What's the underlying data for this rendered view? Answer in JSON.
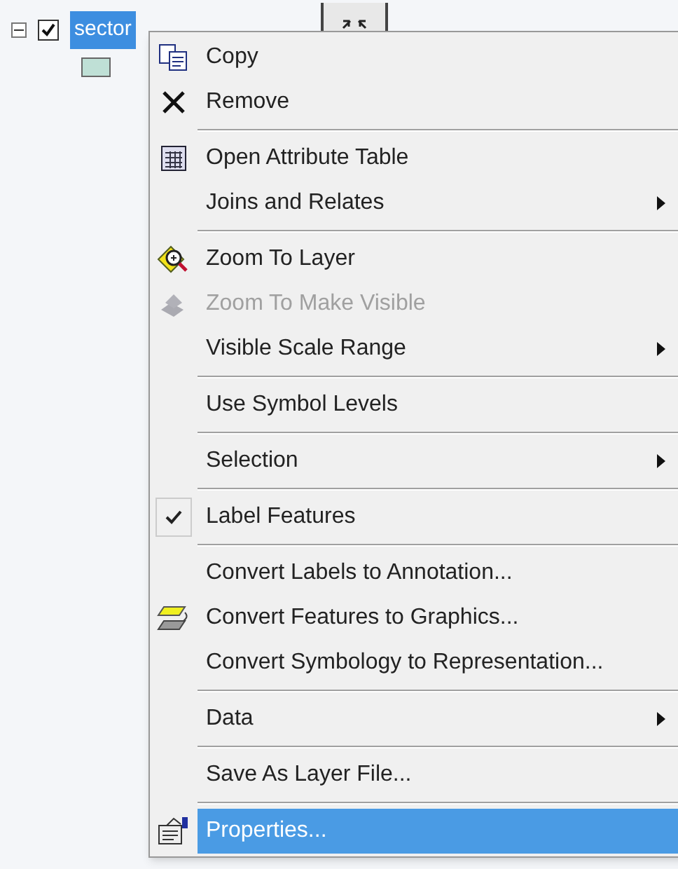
{
  "layer": {
    "expanded": true,
    "checked": true,
    "name": "sector",
    "selected": true
  },
  "menu": {
    "items": [
      {
        "kind": "item",
        "label": "Copy",
        "disabled": false,
        "checked": false,
        "submenu": false,
        "selected": false
      },
      {
        "kind": "item",
        "label": "Remove",
        "disabled": false,
        "checked": false,
        "submenu": false,
        "selected": false
      },
      {
        "kind": "separator"
      },
      {
        "kind": "item",
        "label": "Open Attribute Table",
        "disabled": false,
        "checked": false,
        "submenu": false,
        "selected": false
      },
      {
        "kind": "item",
        "label": "Joins and Relates",
        "disabled": false,
        "checked": false,
        "submenu": true,
        "selected": false
      },
      {
        "kind": "separator"
      },
      {
        "kind": "item",
        "label": "Zoom To Layer",
        "disabled": false,
        "checked": false,
        "submenu": false,
        "selected": false
      },
      {
        "kind": "item",
        "label": "Zoom To Make Visible",
        "disabled": true,
        "checked": false,
        "submenu": false,
        "selected": false
      },
      {
        "kind": "item",
        "label": "Visible Scale Range",
        "disabled": false,
        "checked": false,
        "submenu": true,
        "selected": false
      },
      {
        "kind": "separator"
      },
      {
        "kind": "item",
        "label": "Use Symbol Levels",
        "disabled": false,
        "checked": false,
        "submenu": false,
        "selected": false
      },
      {
        "kind": "separator"
      },
      {
        "kind": "item",
        "label": "Selection",
        "disabled": false,
        "checked": false,
        "submenu": true,
        "selected": false
      },
      {
        "kind": "separator"
      },
      {
        "kind": "item",
        "label": "Label Features",
        "disabled": false,
        "checked": true,
        "submenu": false,
        "selected": false
      },
      {
        "kind": "separator"
      },
      {
        "kind": "item",
        "label": "Convert Labels to Annotation...",
        "disabled": false,
        "checked": false,
        "submenu": false,
        "selected": false
      },
      {
        "kind": "item",
        "label": "Convert Features to Graphics...",
        "disabled": false,
        "checked": false,
        "submenu": false,
        "selected": false
      },
      {
        "kind": "item",
        "label": "Convert Symbology to Representation...",
        "disabled": false,
        "checked": false,
        "submenu": false,
        "selected": false
      },
      {
        "kind": "separator"
      },
      {
        "kind": "item",
        "label": "Data",
        "disabled": false,
        "checked": false,
        "submenu": true,
        "selected": false
      },
      {
        "kind": "separator"
      },
      {
        "kind": "item",
        "label": "Save As Layer File...",
        "disabled": false,
        "checked": false,
        "submenu": false,
        "selected": false
      },
      {
        "kind": "separator"
      },
      {
        "kind": "item",
        "label": "Properties...",
        "disabled": false,
        "checked": false,
        "submenu": false,
        "selected": true
      }
    ]
  }
}
